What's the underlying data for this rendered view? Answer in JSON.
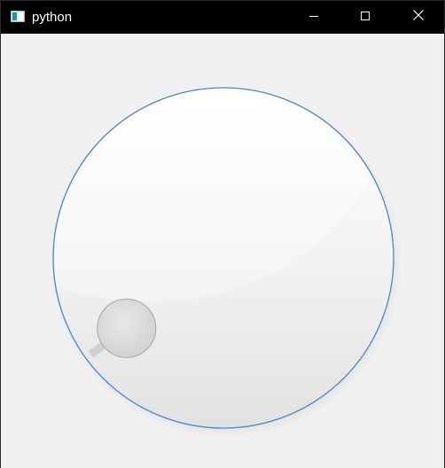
{
  "window": {
    "title": "python",
    "icon": "app-window-icon"
  },
  "titlebar": {
    "minimize_icon": "minimize-icon",
    "maximize_icon": "maximize-icon",
    "close_icon": "close-icon"
  },
  "dial": {
    "type": "rotary-knob",
    "value_fraction": 0.08,
    "indicator_icon": "knob-handle",
    "colors": {
      "rim": "#4a87c5",
      "face_light": "#ffffff",
      "face_dark": "#dcdcdc",
      "handle_fill": "#dadada",
      "handle_border": "#a5a5a5"
    }
  }
}
